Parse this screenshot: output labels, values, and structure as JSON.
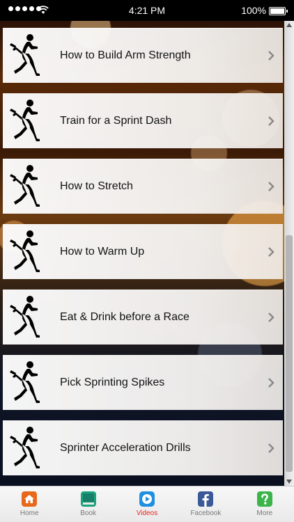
{
  "status_bar": {
    "time": "4:21 PM",
    "battery": "100%"
  },
  "list": {
    "items": [
      {
        "label": "How to Build Arm Strength"
      },
      {
        "label": "Train for a Sprint Dash"
      },
      {
        "label": "How to Stretch"
      },
      {
        "label": "How to Warm Up"
      },
      {
        "label": "Eat & Drink before a Race"
      },
      {
        "label": "Pick Sprinting Spikes"
      },
      {
        "label": "Sprinter Acceleration Drills"
      }
    ],
    "item_icon": "sprinter-silhouette-icon",
    "chevron_icon": "chevron-right-icon"
  },
  "tab_bar": {
    "tabs": [
      {
        "label": "Home",
        "icon": "home-icon",
        "color": "#e8681b"
      },
      {
        "label": "Book",
        "icon": "book-icon",
        "color": "#1aa37a"
      },
      {
        "label": "Videos",
        "icon": "play-icon",
        "color": "#1f8fe0",
        "active": true
      },
      {
        "label": "Facebook",
        "icon": "facebook-icon",
        "color": "#3b5998"
      },
      {
        "label": "More",
        "icon": "question-icon",
        "color": "#3bb54a"
      }
    ],
    "active_color": "#e8251b"
  }
}
